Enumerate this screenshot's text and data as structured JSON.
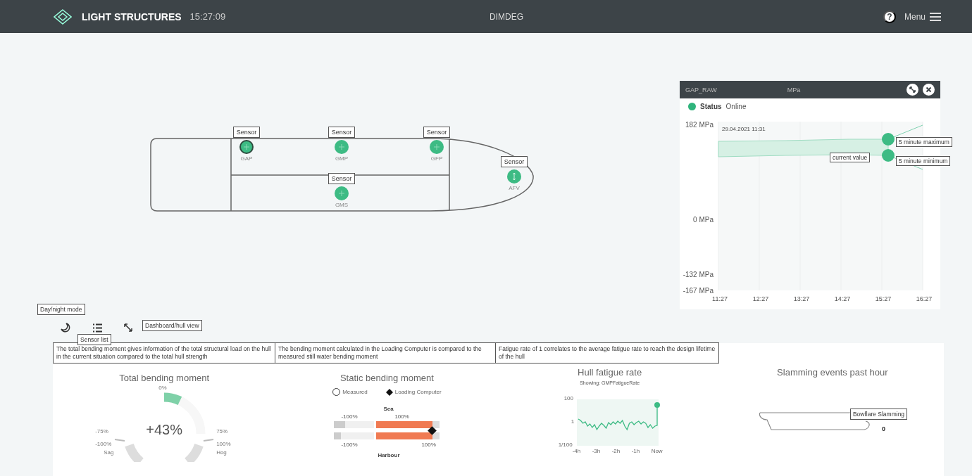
{
  "topbar": {
    "brand": "LIGHT STRUCTURES",
    "time": "15:27:09",
    "title": "DIMDEG",
    "help": "?",
    "menu": "Menu"
  },
  "hull_view": {
    "sensors": [
      {
        "label": "Sensor",
        "name": "GAP",
        "kind": "strain",
        "selected": true
      },
      {
        "label": "Sensor",
        "name": "GMP",
        "kind": "strain",
        "selected": false
      },
      {
        "label": "Sensor",
        "name": "GFP",
        "kind": "strain",
        "selected": false
      },
      {
        "label": "Sensor",
        "name": "AFV",
        "kind": "vertical",
        "selected": false
      },
      {
        "label": "Sensor",
        "name": "GMS",
        "kind": "strain",
        "selected": false
      }
    ]
  },
  "sensor_panel": {
    "title": "GAP_RAW",
    "unit": "MPa",
    "status_label": "Status",
    "status": "Online",
    "date": "29.04.2021 11:31",
    "callouts": [
      "5 minute maximum",
      "current value",
      "5 minute minimum"
    ],
    "y_labels": [
      "182 MPa",
      "0 MPa",
      "-132 MPa",
      "-167 MPa"
    ],
    "x_labels": [
      "11:27",
      "12:27",
      "13:27",
      "14:27",
      "15:27",
      "16:27"
    ]
  },
  "toolbar": {
    "day_night_tip": "Day/night mode",
    "sensor_list_tip": "Sensor list",
    "view_tip": "Dashboard/hull view"
  },
  "info_tips": [
    "The total bending moment gives information of the total structural load on the hull in the current situation compared to the total hull strength",
    "The bending moment calculated in the Loading Computer is compared to the measured still water bending moment",
    "Fatigue rate of 1 correlates to the average fatigue rate to reach the design lifetime of the hull"
  ],
  "total_bending": {
    "title": "Total bending moment",
    "value": "+43%",
    "level": 0.43,
    "top_label": "0%",
    "left_labels": [
      "-75%",
      "-100%",
      "Sag"
    ],
    "right_labels": [
      "75%",
      "100%",
      "Hog"
    ]
  },
  "static_bending": {
    "title": "Static bending moment",
    "legend": [
      "Measured",
      "Loading Computer"
    ],
    "top_label": "Sea",
    "bottom_label": "Harbour",
    "top_ticks": [
      "-100%",
      "100%"
    ],
    "bottom_ticks": [
      "-100%",
      "100%"
    ],
    "bars": [
      {
        "level": 0.88
      },
      {
        "level": 0.88
      }
    ]
  },
  "fatigue": {
    "title": "Hull fatigue rate",
    "subtitle": "Showing: GMPFatigueRate",
    "y_ticks": [
      "100",
      "1",
      "1/100"
    ],
    "x_ticks": [
      "-4h",
      "-3h",
      "-2h",
      "-1h",
      "Now"
    ]
  },
  "slamming": {
    "title": "Slamming events past hour",
    "tip": "Bowflare Slamming",
    "count": "0"
  }
}
